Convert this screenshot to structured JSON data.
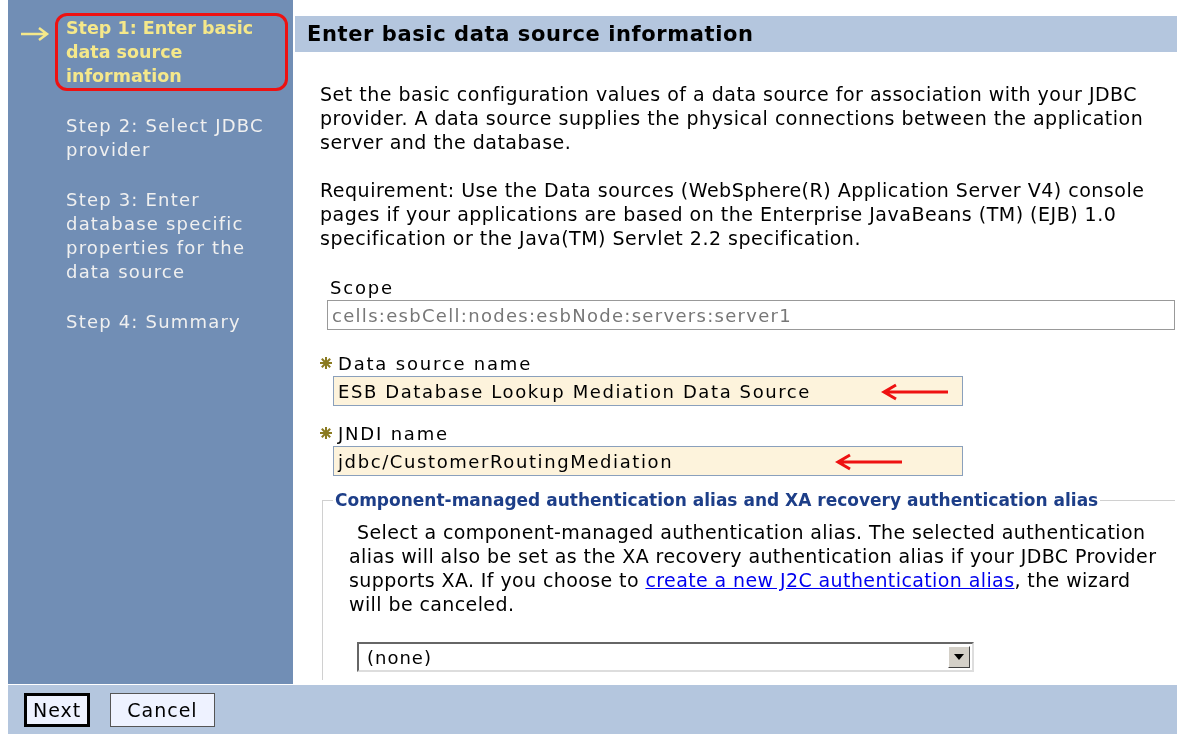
{
  "steps": [
    {
      "label": "Step 1: Enter basic data source information",
      "selected": true,
      "circled": true
    },
    {
      "label": "Step 2: Select JDBC provider",
      "selected": false,
      "circled": false
    },
    {
      "label": "Step 3: Enter database specific properties for the data source",
      "selected": false,
      "circled": false
    },
    {
      "label": "Step 4: Summary",
      "selected": false,
      "circled": false
    }
  ],
  "heading": "Enter basic data source information",
  "paragraphs": [
    "Set the basic configuration values of a data source for association with your JDBC provider. A data source supplies the physical connections between the application server and the database.",
    "Requirement: Use the Data sources (WebSphere(R) Application Server V4) console pages if your applications are based on the Enterprise JavaBeans (TM) (EJB) 1.0 specification or the Java(TM) Servlet 2.2 specification."
  ],
  "fields": [
    {
      "label": "Scope",
      "value": "cells:esbCell:nodes:esbNode:servers:server1",
      "required": false,
      "disabled": true,
      "arrow": false
    },
    {
      "label": "Data source name",
      "value": "ESB Database Lookup Mediation Data Source",
      "required": true,
      "disabled": false,
      "arrow": true
    },
    {
      "label": "JNDI name",
      "value": "jdbc/CustomerRoutingMediation",
      "required": true,
      "disabled": false,
      "arrow": true
    }
  ],
  "auth_group": {
    "legend": "Component-managed authentication alias and XA recovery authentication alias",
    "text_before": "Select a component-managed authentication alias. The selected authentication alias will also be set as the XA recovery authentication alias if your JDBC Provider supports XA. If you choose to",
    "link": "create a new J2C authentication alias",
    "text_after": ", the wizard will be canceled.",
    "select": {
      "value": "(none)"
    }
  },
  "buttons": [
    {
      "label": "Next",
      "default": true
    },
    {
      "label": "Cancel",
      "default": false
    }
  ]
}
